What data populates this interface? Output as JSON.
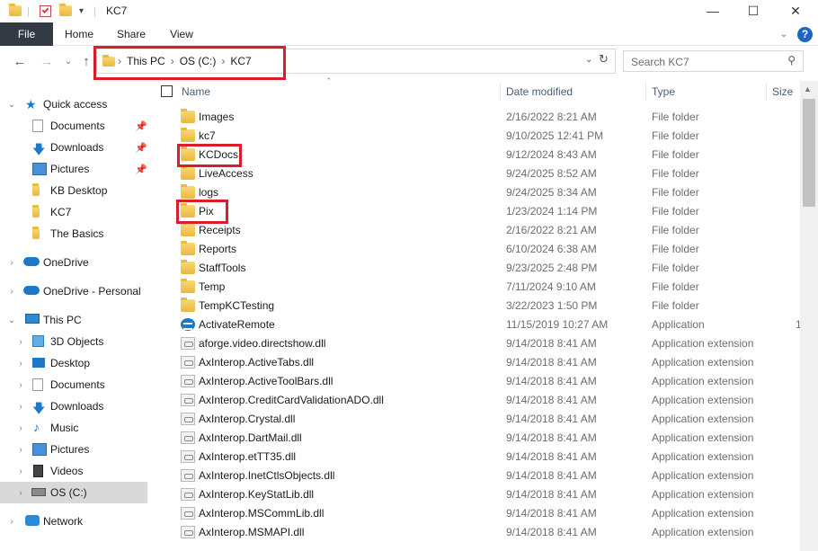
{
  "window": {
    "title": "KC7"
  },
  "ribbon": {
    "tabs": [
      "File",
      "Home",
      "Share",
      "View"
    ]
  },
  "address": {
    "crumbs": [
      "This PC",
      "OS (C:)",
      "KC7"
    ],
    "search_placeholder": "Search KC7"
  },
  "sidebar": {
    "quick_access": "Quick access",
    "quick_items": [
      "Documents",
      "Downloads",
      "Pictures",
      "KB Desktop",
      "KC7",
      "The Basics"
    ],
    "onedrive": "OneDrive",
    "onedrive_personal": "OneDrive - Personal",
    "this_pc": "This PC",
    "pc_items": [
      "3D Objects",
      "Desktop",
      "Documents",
      "Downloads",
      "Music",
      "Pictures",
      "Videos",
      "OS (C:)"
    ],
    "network": "Network"
  },
  "columns": {
    "name": "Name",
    "date": "Date modified",
    "type": "Type",
    "size": "Size"
  },
  "files": [
    {
      "name": "Images",
      "date": "2/16/2022 8:21 AM",
      "type": "File folder",
      "size": "",
      "icon": "folder"
    },
    {
      "name": "kc7",
      "date": "9/10/2025 12:41 PM",
      "type": "File folder",
      "size": "",
      "icon": "folder"
    },
    {
      "name": "KCDocs",
      "date": "9/12/2024 8:43 AM",
      "type": "File folder",
      "size": "",
      "icon": "folder"
    },
    {
      "name": "LiveAccess",
      "date": "9/24/2025 8:52 AM",
      "type": "File folder",
      "size": "",
      "icon": "folder"
    },
    {
      "name": "logs",
      "date": "9/24/2025 8:34 AM",
      "type": "File folder",
      "size": "",
      "icon": "folder"
    },
    {
      "name": "Pix",
      "date": "1/23/2024 1:14 PM",
      "type": "File folder",
      "size": "",
      "icon": "folder"
    },
    {
      "name": "Receipts",
      "date": "2/16/2022 8:21 AM",
      "type": "File folder",
      "size": "",
      "icon": "folder"
    },
    {
      "name": "Reports",
      "date": "6/10/2024 6:38 AM",
      "type": "File folder",
      "size": "",
      "icon": "folder"
    },
    {
      "name": "StaffTools",
      "date": "9/23/2025 2:48 PM",
      "type": "File folder",
      "size": "",
      "icon": "folder"
    },
    {
      "name": "Temp",
      "date": "7/11/2024 9:10 AM",
      "type": "File folder",
      "size": "",
      "icon": "folder"
    },
    {
      "name": "TempKCTesting",
      "date": "3/22/2023 1:50 PM",
      "type": "File folder",
      "size": "",
      "icon": "folder"
    },
    {
      "name": "ActivateRemote",
      "date": "11/15/2019 10:27 AM",
      "type": "Application",
      "size": "1",
      "icon": "app"
    },
    {
      "name": "aforge.video.directshow.dll",
      "date": "9/14/2018 8:41 AM",
      "type": "Application extension",
      "size": "",
      "icon": "dll"
    },
    {
      "name": "AxInterop.ActiveTabs.dll",
      "date": "9/14/2018 8:41 AM",
      "type": "Application extension",
      "size": "",
      "icon": "dll"
    },
    {
      "name": "AxInterop.ActiveToolBars.dll",
      "date": "9/14/2018 8:41 AM",
      "type": "Application extension",
      "size": "",
      "icon": "dll"
    },
    {
      "name": "AxInterop.CreditCardValidationADO.dll",
      "date": "9/14/2018 8:41 AM",
      "type": "Application extension",
      "size": "",
      "icon": "dll"
    },
    {
      "name": "AxInterop.Crystal.dll",
      "date": "9/14/2018 8:41 AM",
      "type": "Application extension",
      "size": "",
      "icon": "dll"
    },
    {
      "name": "AxInterop.DartMail.dll",
      "date": "9/14/2018 8:41 AM",
      "type": "Application extension",
      "size": "",
      "icon": "dll"
    },
    {
      "name": "AxInterop.etTT35.dll",
      "date": "9/14/2018 8:41 AM",
      "type": "Application extension",
      "size": "",
      "icon": "dll"
    },
    {
      "name": "AxInterop.InetCtlsObjects.dll",
      "date": "9/14/2018 8:41 AM",
      "type": "Application extension",
      "size": "",
      "icon": "dll"
    },
    {
      "name": "AxInterop.KeyStatLib.dll",
      "date": "9/14/2018 8:41 AM",
      "type": "Application extension",
      "size": "",
      "icon": "dll"
    },
    {
      "name": "AxInterop.MSCommLib.dll",
      "date": "9/14/2018 8:41 AM",
      "type": "Application extension",
      "size": "",
      "icon": "dll"
    },
    {
      "name": "AxInterop.MSMAPI.dll",
      "date": "9/14/2018 8:41 AM",
      "type": "Application extension",
      "size": "",
      "icon": "dll"
    }
  ],
  "highlight_color": "#d81e2a"
}
